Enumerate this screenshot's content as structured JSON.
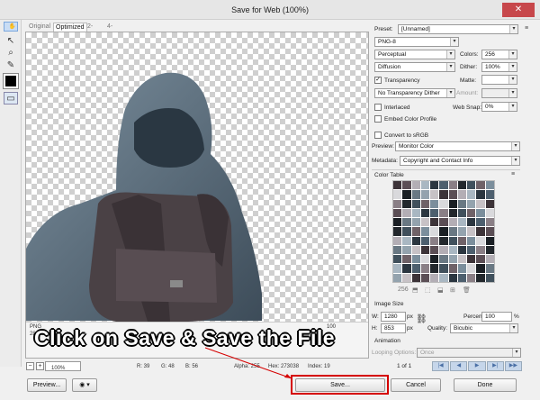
{
  "window": {
    "title": "Save for Web (100%)",
    "close_glyph": "✕"
  },
  "tabs": [
    "Original",
    "Optimized",
    "2-Up",
    "4-Up"
  ],
  "tools": [
    "hand-icon",
    "slice-select-icon",
    "zoom-icon",
    "eyedropper-icon"
  ],
  "image_info": {
    "format": "PNG",
    "size": "100",
    "lines": "28 bit Scaled"
  },
  "caption": "Click on Save & Save the File",
  "status": {
    "zoom": "100%",
    "r": "R: 39",
    "g": "G: 48",
    "b": "B: 56",
    "alpha": "Alpha: 255",
    "hex": "Hex: 273038",
    "index": "Index: 19"
  },
  "buttons": {
    "preview": "Preview...",
    "save": "Save...",
    "cancel": "Cancel",
    "done": "Done"
  },
  "settings": {
    "preset_label": "Preset:",
    "preset_value": "[Unnamed]",
    "format": "PNG-8",
    "reduction": "Perceptual",
    "colors_label": "Colors:",
    "colors_value": "256",
    "dither_algo": "Diffusion",
    "dither_label": "Dither:",
    "dither_value": "100%",
    "transparency_label": "Transparency",
    "matte_label": "Matte:",
    "trans_dither": "No Transparency Dither",
    "amount_label": "Amount:",
    "interlaced_label": "Interlaced",
    "websnap_label": "Web Snap:",
    "websnap_value": "0%",
    "embed_label": "Embed Color Profile",
    "srgb_label": "Convert to sRGB",
    "preview_label": "Preview:",
    "preview_value": "Monitor Color",
    "metadata_label": "Metadata:",
    "metadata_value": "Copyright and Contact Info"
  },
  "color_table": {
    "title": "Color Table",
    "count": "256"
  },
  "image_size": {
    "title": "Image Size",
    "w_label": "W:",
    "w_value": "1280",
    "h_label": "H:",
    "h_value": "853",
    "unit": "px",
    "percent_label": "Percent:",
    "percent_value": "100",
    "percent_unit": "%",
    "quality_label": "Quality:",
    "quality_value": "Bicubic"
  },
  "animation": {
    "title": "Animation",
    "looping_label": "Looping Options:",
    "looping_value": "Once",
    "frame": "1 of 1"
  },
  "colors": {
    "accent": "#d50000",
    "caption": "#ffffff"
  }
}
